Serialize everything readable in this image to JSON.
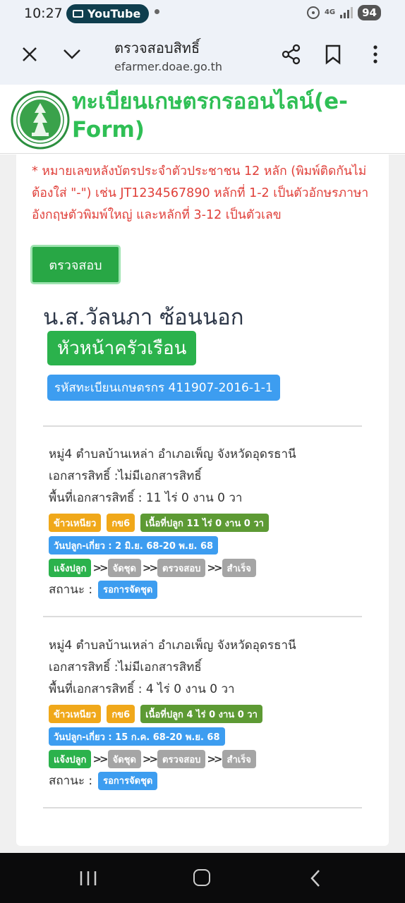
{
  "status_bar": {
    "time": "10:27",
    "notification_pill": "YouTube",
    "network": "4G",
    "battery": "94"
  },
  "browser": {
    "page_title": "ตรวจสอบสิทธิ์",
    "url": "efarmer.doae.go.th"
  },
  "site": {
    "title": "ทะเบียนเกษตรกรออนไลน์(e-Form)"
  },
  "form": {
    "note": "* หมายเลขหลังบัตรประจำตัวประชาชน 12 หลัก (พิมพ์ติดกันไม่ต้องใส่ \"-\") เช่น JT1234567890 หลักที่ 1-2 เป็นตัวอักษรภาษาอังกฤษตัวพิมพ์ใหญ่ และหลักที่ 3-12 เป็นตัวเลข",
    "check_button": "ตรวจสอบ"
  },
  "farmer": {
    "name": "น.ส.วัลนภา ซ้อนนอก",
    "role": "หัวหน้าครัวเรือน",
    "registration": "รหัสทะเบียนเกษตรกร 411907-2016-1-1"
  },
  "plots": [
    {
      "location": "หมู่4 ตำบลบ้านเหล่า อำเภอเพ็ญ จังหวัดอุดรธานี",
      "document": "เอกสารสิทธิ์ :ไม่มีเอกสารสิทธิ์",
      "area": "พื้นที่เอกสารสิทธิ์ : 11 ไร่ 0 งาน 0 วา",
      "crop": "ข้าวเหนียว",
      "variety": "กข6",
      "planted_area": "เนื้อที่ปลูก 11 ไร่ 0 งาน 0 วา",
      "dates": "วันปลูก-เกี่ยว : 2 มิ.ย. 68-20 พ.ย. 68",
      "steps": [
        "แจ้งปลูก",
        "จัดชุด",
        "ตรวจสอบ",
        "สำเร็จ"
      ],
      "status_label": "สถานะ :",
      "status": "รอการจัดชุด"
    },
    {
      "location": "หมู่4 ตำบลบ้านเหล่า อำเภอเพ็ญ จังหวัดอุดรธานี",
      "document": "เอกสารสิทธิ์ :ไม่มีเอกสารสิทธิ์",
      "area": "พื้นที่เอกสารสิทธิ์ : 4 ไร่ 0 งาน 0 วา",
      "crop": "ข้าวเหนียว",
      "variety": "กข6",
      "planted_area": "เนื้อที่ปลูก 4 ไร่ 0 งาน 0 วา",
      "dates": "วันปลูก-เกี่ยว : 15 ก.ค. 68-20 พ.ย. 68",
      "steps": [
        "แจ้งปลูก",
        "จัดชุด",
        "ตรวจสอบ",
        "สำเร็จ"
      ],
      "status_label": "สถานะ :",
      "status": "รอการจัดชุด"
    }
  ],
  "colors": {
    "brand_green": "#2fbf55",
    "button_green": "#28a745",
    "note_red": "#e0403a",
    "badge_blue": "#3d9df0",
    "tag_orange": "#f0a81a"
  }
}
